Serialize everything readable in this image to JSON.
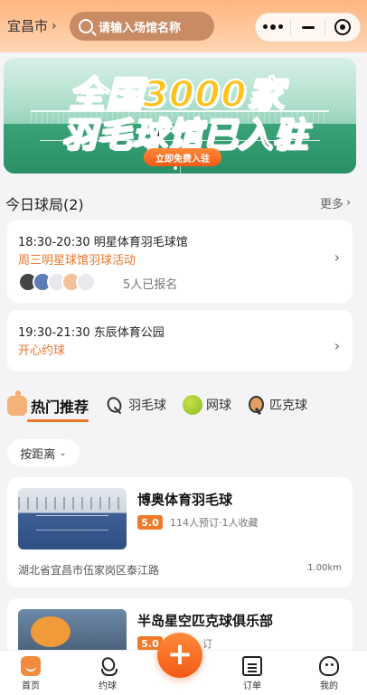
{
  "header": {
    "city": "宜昌市",
    "search_placeholder": "请输入场馆名称"
  },
  "banner": {
    "line1_prefix": "全国",
    "line1_number": "3000",
    "line1_suffix": "家",
    "line2": "羽毛球馆已入驻",
    "cta": "立即免费入驻"
  },
  "today": {
    "title": "今日球局(2)",
    "more": "更多",
    "games": [
      {
        "time_venue": "18:30-20:30 明星体育羽毛球馆",
        "activity": "周三明星球馆羽球活动",
        "signed": "5人已报名"
      },
      {
        "time_venue": "19:30-21:30 东辰体育公园",
        "activity": "开心约球"
      }
    ]
  },
  "tabs": [
    {
      "label": "热门推荐",
      "icon": "thumbs-up-icon",
      "active": true
    },
    {
      "label": "羽毛球",
      "icon": "badminton-icon"
    },
    {
      "label": "网球",
      "icon": "tennis-ball-icon"
    },
    {
      "label": "匹克球",
      "icon": "pickleball-paddle-icon"
    }
  ],
  "sort": {
    "label": "按距离"
  },
  "venues": [
    {
      "name": "博奥体育羽毛球",
      "score": "5.0",
      "stats": "114人预订·1人收藏",
      "address": "湖北省宜昌市伍家岗区泰江路",
      "distance": "1.00km"
    },
    {
      "name": "半岛星空匹克球俱乐部",
      "score": "5.0",
      "stats": "订"
    }
  ],
  "bottom_nav": {
    "home": "首页",
    "game": "约球",
    "order": "订单",
    "mine": "我的",
    "fab": "+"
  },
  "colors": {
    "accent": "#f0732a",
    "header_gradient_top": "#ffb57e"
  }
}
